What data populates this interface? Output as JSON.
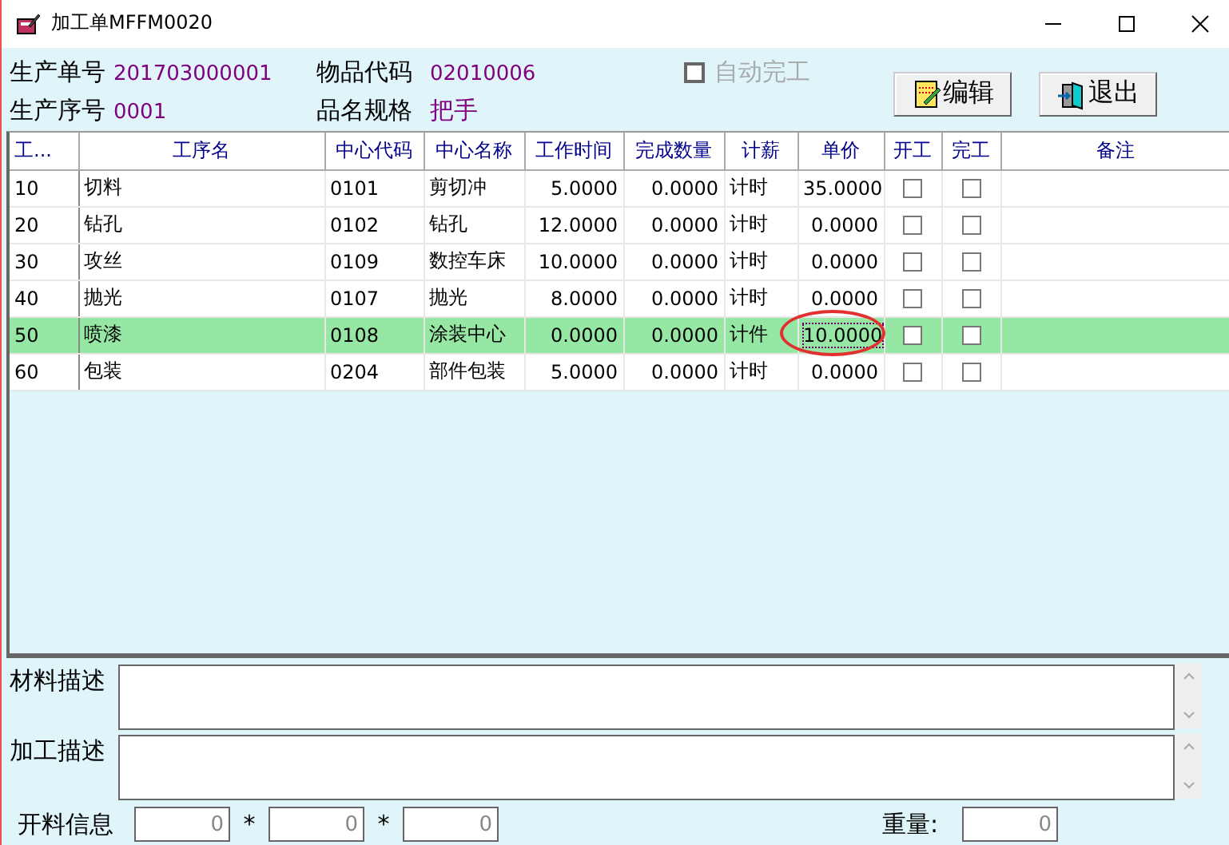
{
  "window": {
    "title": "加工单MFFM0020"
  },
  "header": {
    "fields": [
      {
        "label": "生产单号",
        "value": "201703000001"
      },
      {
        "label": "物品代码",
        "value": "02010006"
      },
      {
        "label": "生产序号",
        "value": "0001"
      },
      {
        "label": "品名规格",
        "value": "把手"
      }
    ],
    "auto_complete": {
      "label": "自动完工",
      "checked": false,
      "disabled": true
    },
    "buttons": [
      {
        "label": "编辑",
        "kind": "edit"
      },
      {
        "label": "退出",
        "kind": "exit"
      }
    ]
  },
  "table": {
    "columns": [
      "工...",
      "工序名",
      "中心代码",
      "中心名称",
      "工作时间",
      "完成数量",
      "计薪",
      "单价",
      "开工",
      "完工",
      "备注"
    ],
    "rows": [
      {
        "seq": "10",
        "name": "切料",
        "center_code": "0101",
        "center_name": "剪切冲",
        "work_time": "5.0000",
        "done_qty": "0.0000",
        "pay": "计时",
        "price": "35.0000",
        "started": false,
        "finished": false,
        "selected": false,
        "price_circled": false
      },
      {
        "seq": "20",
        "name": "钻孔",
        "center_code": "0102",
        "center_name": "钻孔",
        "work_time": "12.0000",
        "done_qty": "0.0000",
        "pay": "计时",
        "price": "0.0000",
        "started": false,
        "finished": false,
        "selected": false,
        "price_circled": false
      },
      {
        "seq": "30",
        "name": "攻丝",
        "center_code": "0109",
        "center_name": "数控车床",
        "work_time": "10.0000",
        "done_qty": "0.0000",
        "pay": "计时",
        "price": "0.0000",
        "started": false,
        "finished": false,
        "selected": false,
        "price_circled": false
      },
      {
        "seq": "40",
        "name": "抛光",
        "center_code": "0107",
        "center_name": "抛光",
        "work_time": "8.0000",
        "done_qty": "0.0000",
        "pay": "计时",
        "price": "0.0000",
        "started": false,
        "finished": false,
        "selected": false,
        "price_circled": false
      },
      {
        "seq": "50",
        "name": "喷漆",
        "center_code": "0108",
        "center_name": "涂装中心",
        "work_time": "0.0000",
        "done_qty": "0.0000",
        "pay": "计件",
        "price": "10.0000",
        "started": false,
        "finished": false,
        "selected": true,
        "price_circled": true
      },
      {
        "seq": "60",
        "name": "包装",
        "center_code": "0204",
        "center_name": "部件包装",
        "work_time": "5.0000",
        "done_qty": "0.0000",
        "pay": "计时",
        "price": "0.0000",
        "started": false,
        "finished": false,
        "selected": false,
        "price_circled": false
      }
    ]
  },
  "material_description": {
    "label": "材料描述"
  },
  "process_description": {
    "label": "加工描述"
  },
  "cutting_info": {
    "label": "开料信息",
    "values": [
      "0",
      "0",
      "0"
    ],
    "separators": [
      "*",
      "*"
    ]
  },
  "weight": {
    "label": "重量:",
    "value": "0"
  }
}
